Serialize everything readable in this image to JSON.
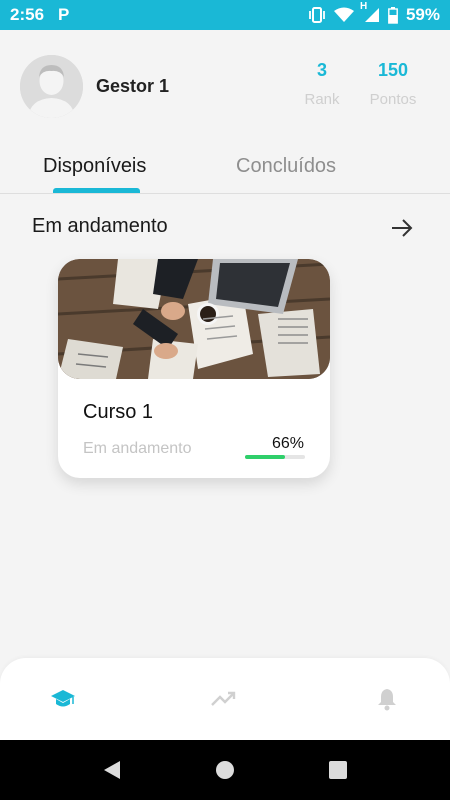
{
  "status_bar": {
    "time": "2:56",
    "app_icon": "P",
    "battery": "59%",
    "network": "H"
  },
  "profile": {
    "username": "Gestor 1",
    "rank_value": "3",
    "rank_label": "Rank",
    "points_value": "150",
    "points_label": "Pontos"
  },
  "tabs": [
    {
      "label": "Disponíveis",
      "active": true
    },
    {
      "label": "Concluídos",
      "active": false
    }
  ],
  "section": {
    "title": "Em andamento"
  },
  "course_card": {
    "title": "Curso 1",
    "status": "Em andamento",
    "progress_label": "66%",
    "progress_fraction": 0.66
  },
  "bottom_nav": [
    {
      "icon": "graduation-cap-icon",
      "active": true
    },
    {
      "icon": "trending-up-icon",
      "active": false
    },
    {
      "icon": "bell-icon",
      "active": false
    }
  ],
  "colors": {
    "accent": "#1ab8d6",
    "progress": "#2fcf6b",
    "inactive": "#c4c4c4"
  }
}
